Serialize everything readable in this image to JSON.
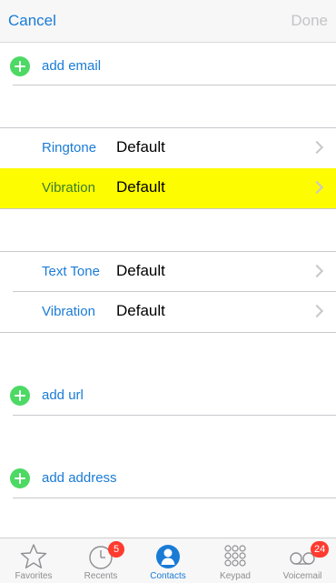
{
  "navbar": {
    "cancel_label": "Cancel",
    "done_label": "Done"
  },
  "add_email": {
    "label": "add email"
  },
  "ringtone": {
    "label": "Ringtone",
    "value": "Default"
  },
  "ringtone_vibration": {
    "label": "Vibration",
    "value": "Default",
    "highlighted": true,
    "highlight_color": "#fdfc00"
  },
  "text_tone": {
    "label": "Text Tone",
    "value": "Default"
  },
  "text_tone_vibration": {
    "label": "Vibration",
    "value": "Default"
  },
  "add_url": {
    "label": "add url"
  },
  "add_address": {
    "label": "add address"
  },
  "tabbar": {
    "tabs": [
      {
        "label": "Favorites",
        "icon": "star-icon"
      },
      {
        "label": "Recents",
        "icon": "clock-icon",
        "badge": "5"
      },
      {
        "label": "Contacts",
        "icon": "person-icon",
        "active": true
      },
      {
        "label": "Keypad",
        "icon": "keypad-icon"
      },
      {
        "label": "Voicemail",
        "icon": "voicemail-icon",
        "badge": "24"
      }
    ]
  },
  "colors": {
    "accent": "#1a7bd6",
    "add_green": "#4cd964",
    "badge_red": "#ff3b30",
    "done_disabled": "#c4c4c8"
  }
}
